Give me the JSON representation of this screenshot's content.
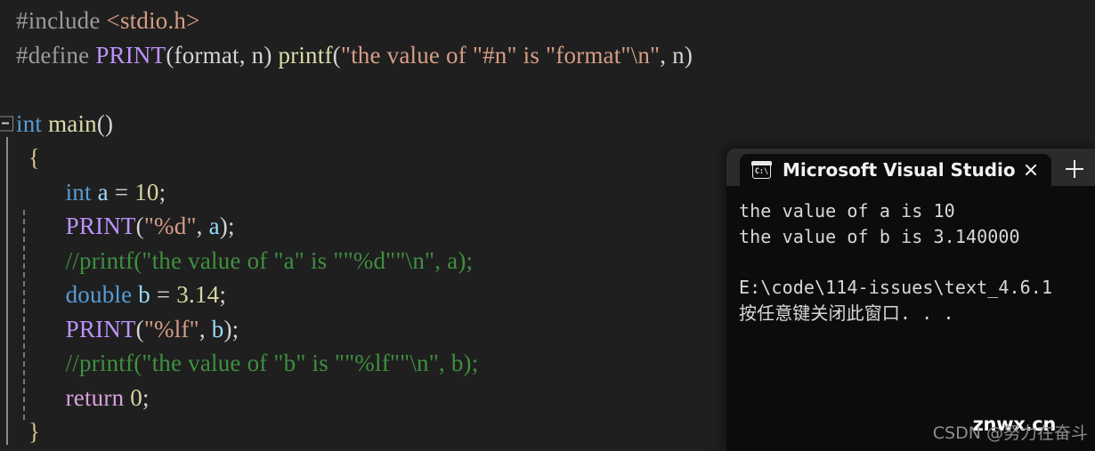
{
  "editor": {
    "name": "visual-studio-code-editor",
    "background": "#1f1f1f",
    "collapse_glyph": "minus",
    "lines": [
      {
        "id": "line-include",
        "tokens": [
          {
            "cls": "pp",
            "t": "#include "
          },
          {
            "cls": "hdr",
            "t": "<stdio.h>"
          }
        ]
      },
      {
        "id": "line-define",
        "tokens": [
          {
            "cls": "pp",
            "t": "#define "
          },
          {
            "cls": "macro",
            "t": "PRINT"
          },
          {
            "cls": "punc",
            "t": "("
          },
          {
            "cls": "plain",
            "t": "format, n"
          },
          {
            "cls": "punc",
            "t": ") "
          },
          {
            "cls": "fn",
            "t": "printf"
          },
          {
            "cls": "punc",
            "t": "("
          },
          {
            "cls": "str",
            "t": "\"the value of \"#n\" is \"format\"\\n\""
          },
          {
            "cls": "punc",
            "t": ", "
          },
          {
            "cls": "plain",
            "t": "n"
          },
          {
            "cls": "punc",
            "t": ")"
          }
        ]
      },
      {
        "id": "line-blank-1",
        "tokens": []
      },
      {
        "id": "line-main",
        "collapse": true,
        "tokens": [
          {
            "cls": "kw",
            "t": "int "
          },
          {
            "cls": "fn",
            "t": "main"
          },
          {
            "cls": "punc",
            "t": "()"
          }
        ]
      },
      {
        "id": "line-open-brace",
        "indent": 1,
        "tokens": [
          {
            "cls": "brace",
            "t": "{"
          }
        ]
      },
      {
        "id": "line-int-a",
        "indent": 4,
        "tokens": [
          {
            "cls": "kw",
            "t": "int "
          },
          {
            "cls": "var",
            "t": "a"
          },
          {
            "cls": "punc",
            "t": " = "
          },
          {
            "cls": "num",
            "t": "10"
          },
          {
            "cls": "punc",
            "t": ";"
          }
        ]
      },
      {
        "id": "line-print-a",
        "indent": 4,
        "tokens": [
          {
            "cls": "macro",
            "t": "PRINT"
          },
          {
            "cls": "punc",
            "t": "("
          },
          {
            "cls": "str",
            "t": "\"%d\""
          },
          {
            "cls": "punc",
            "t": ", "
          },
          {
            "cls": "var",
            "t": "a"
          },
          {
            "cls": "punc",
            "t": ");"
          }
        ]
      },
      {
        "id": "line-comment-a",
        "indent": 4,
        "tokens": [
          {
            "cls": "cmt",
            "t": "//printf(\"the value of \"a\" is \"\"%d\"\"\\n\", a);"
          }
        ]
      },
      {
        "id": "line-double-b",
        "indent": 4,
        "tokens": [
          {
            "cls": "kw",
            "t": "double "
          },
          {
            "cls": "var",
            "t": "b"
          },
          {
            "cls": "punc",
            "t": " = "
          },
          {
            "cls": "num",
            "t": "3.14"
          },
          {
            "cls": "punc",
            "t": ";"
          }
        ]
      },
      {
        "id": "line-print-b",
        "indent": 4,
        "tokens": [
          {
            "cls": "macro",
            "t": "PRINT"
          },
          {
            "cls": "punc",
            "t": "("
          },
          {
            "cls": "str",
            "t": "\"%lf\""
          },
          {
            "cls": "punc",
            "t": ", "
          },
          {
            "cls": "var",
            "t": "b"
          },
          {
            "cls": "punc",
            "t": ");"
          }
        ]
      },
      {
        "id": "line-comment-b",
        "indent": 4,
        "tokens": [
          {
            "cls": "cmt",
            "t": "//printf(\"the value of \"b\" is \"\"%lf\"\"\\n\", b);"
          }
        ]
      },
      {
        "id": "line-return",
        "indent": 4,
        "tokens": [
          {
            "cls": "kw2",
            "t": "return "
          },
          {
            "cls": "num",
            "t": "0"
          },
          {
            "cls": "punc",
            "t": ";"
          }
        ]
      },
      {
        "id": "line-close-brace",
        "indent": 1,
        "tokens": [
          {
            "cls": "brace",
            "t": "}"
          }
        ]
      }
    ]
  },
  "console": {
    "tab": {
      "icon": "cmd-console-icon",
      "icon_label": "C:\\",
      "title": "Microsoft Visual Studio",
      "close_label": "×",
      "new_tab_label": "+"
    },
    "output": [
      "the value of a is 10",
      "the value of b is 3.140000",
      "",
      "E:\\code\\114-issues\\text_4.6.1",
      "按任意键关闭此窗口. . ."
    ],
    "colors": {
      "titlebar": "#2b2b2b",
      "body": "#0c0c0c",
      "text": "#d8d8d8"
    }
  },
  "watermarks": {
    "csdn": "CSDN @努力在奋斗",
    "site": "znwx.cn"
  }
}
